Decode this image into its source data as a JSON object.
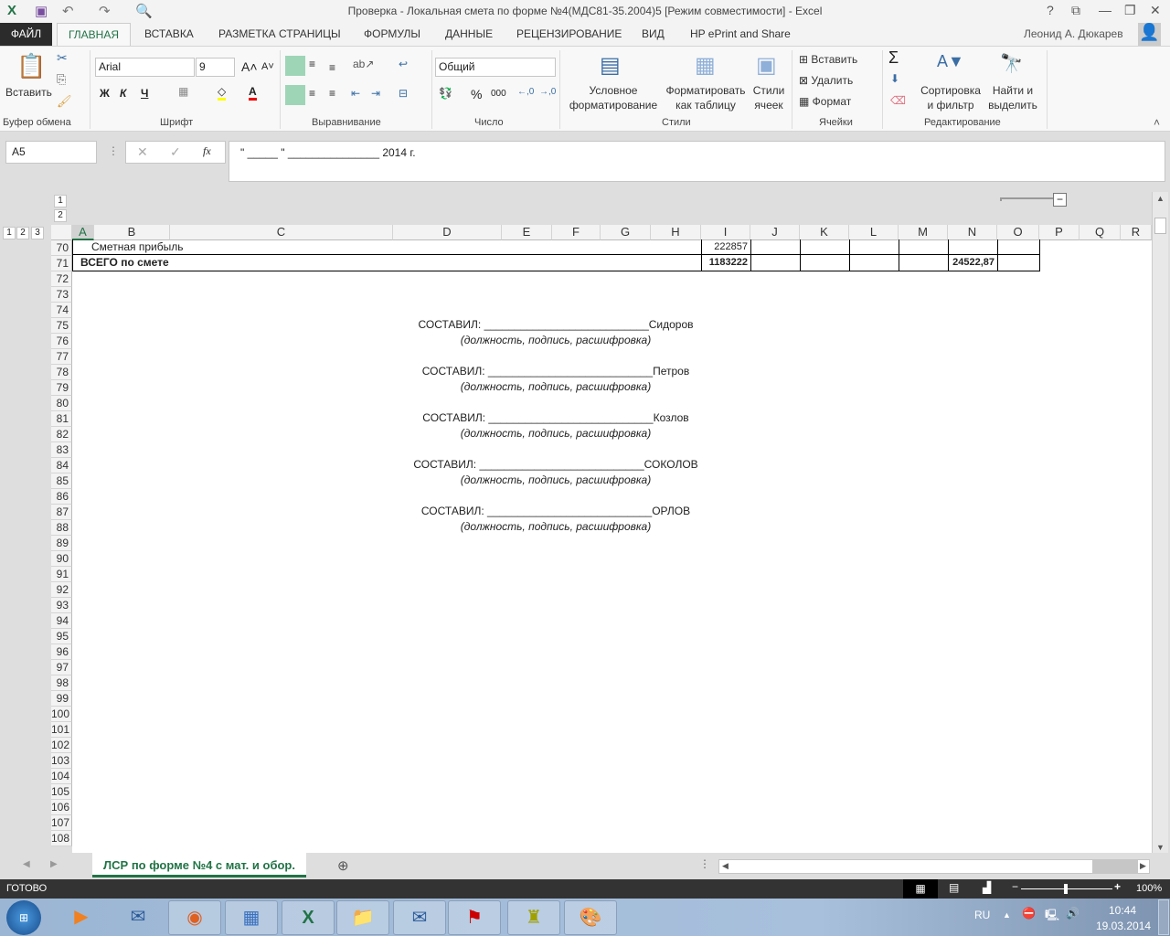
{
  "title": "Проверка - Локальная смета по форме №4(МДС81-35.2004)5  [Режим совместимости] - Excel",
  "window_buttons": [
    "?",
    "⧉",
    "—",
    "❐",
    "✕"
  ],
  "tabs": {
    "file": "ФАЙЛ",
    "items": [
      "ГЛАВНАЯ",
      "ВСТАВКА",
      "РАЗМЕТКА СТРАНИЦЫ",
      "ФОРМУЛЫ",
      "ДАННЫЕ",
      "РЕЦЕНЗИРОВАНИЕ",
      "ВИД",
      "HP ePrint and Share"
    ]
  },
  "user": "Леонид А. Дюкарев",
  "ribbon": {
    "paste": "Вставить",
    "font_name": "Arial",
    "font_size": "9",
    "bold": "Ж",
    "italic": "К",
    "underline": "Ч",
    "number_format": "Общий",
    "percent": "%",
    "thousands": "000",
    "cond_format": [
      "Условное",
      "форматирование"
    ],
    "format_table": [
      "Форматировать",
      "как таблицу"
    ],
    "cell_styles": [
      "Стили",
      "ячеек"
    ],
    "insert": "Вставить",
    "delete": "Удалить",
    "format": "Формат",
    "sort": [
      "Сортировка",
      "и фильтр"
    ],
    "find": [
      "Найти и",
      "выделить"
    ],
    "groups": [
      "Буфер обмена",
      "Шрифт",
      "Выравнивание",
      "Число",
      "Стили",
      "Ячейки",
      "Редактирование"
    ]
  },
  "formula_bar": {
    "name_box": "A5",
    "formula": "\" _____ \" _______________ 2014 г.",
    "fx": "fx"
  },
  "outline": {
    "row_levels": [
      "1",
      "2"
    ],
    "col_levels": [
      "1",
      "2",
      "3"
    ]
  },
  "columns": [
    "A",
    "B",
    "C",
    "D",
    "E",
    "F",
    "G",
    "H",
    "I",
    "J",
    "K",
    "L",
    "M",
    "N",
    "O",
    "P",
    "Q",
    "R"
  ],
  "rows": [
    "70",
    "71",
    "72",
    "73",
    "74",
    "75",
    "76",
    "77",
    "78",
    "79",
    "80",
    "81",
    "82",
    "83",
    "84",
    "85",
    "86",
    "87",
    "88",
    "89",
    "90",
    "91",
    "92",
    "93",
    "94",
    "95",
    "96",
    "97",
    "98",
    "99",
    "100",
    "101",
    "102",
    "103",
    "104",
    "105",
    "106",
    "107",
    "108"
  ],
  "cells": {
    "r70_label": "Сметная прибыль",
    "r70_I": "222857",
    "r71_label": "ВСЕГО по смете",
    "r71_I": "1183222",
    "r71_N": "24522,87"
  },
  "signatures": [
    {
      "line": "СОСТАВИЛ: ___________________________Сидоров",
      "note": "(должность, подпись, расшифровка)"
    },
    {
      "line": "СОСТАВИЛ: ___________________________Петров",
      "note": "(должность, подпись, расшифровка)"
    },
    {
      "line": "СОСТАВИЛ: ___________________________Козлов",
      "note": "(должность, подпись, расшифровка)"
    },
    {
      "line": "СОСТАВИЛ: ___________________________СОКОЛОВ",
      "note": "(должность, подпись, расшифровка)"
    },
    {
      "line": "СОСТАВИЛ: ___________________________ОРЛОВ",
      "note": "(должность, подпись, расшифровка)"
    }
  ],
  "sheet_tab": "ЛСР по форме №4 с мат. и обор.",
  "status": {
    "text": "ГОТОВО",
    "zoom": "100%"
  },
  "taskbar": {
    "lang": "RU",
    "time": "10:44",
    "date": "19.03.2014"
  }
}
